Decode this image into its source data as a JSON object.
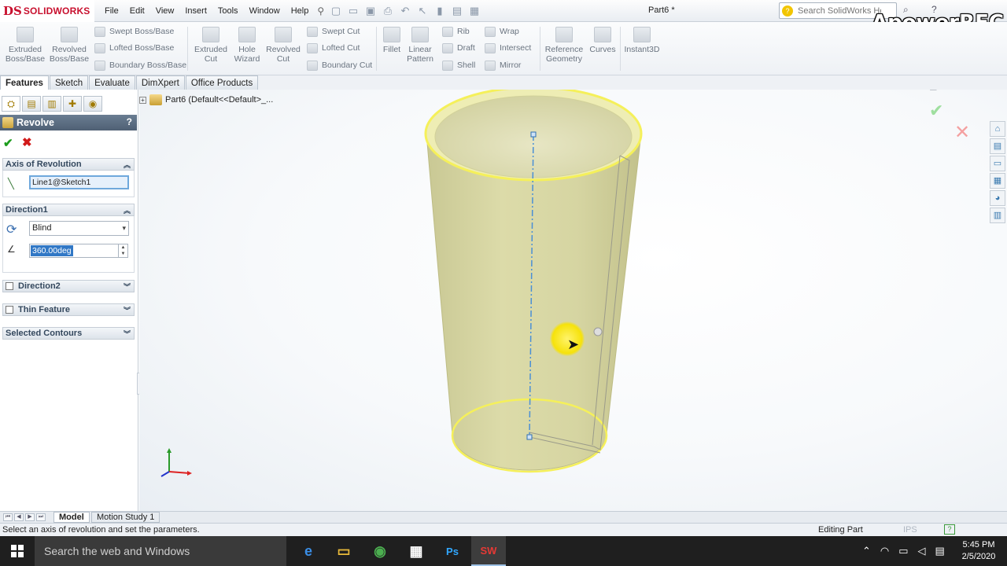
{
  "app": {
    "logo_mark": "DS",
    "logo_name": "SOLIDWORKS",
    "document_title": "Part6 *"
  },
  "menu": [
    "File",
    "Edit",
    "View",
    "Insert",
    "Tools",
    "Window",
    "Help"
  ],
  "search": {
    "placeholder": "Search SolidWorks Help"
  },
  "watermark": "ApowerREC",
  "ribbon": {
    "extruded_boss": "Extruded Boss/Base",
    "revolved_boss": "Revolved Boss/Base",
    "swept_boss": "Swept Boss/Base",
    "lofted_boss": "Lofted Boss/Base",
    "boundary_boss": "Boundary Boss/Base",
    "extruded_cut": "Extruded Cut",
    "hole_wizard": "Hole Wizard",
    "revolved_cut": "Revolved Cut",
    "swept_cut": "Swept Cut",
    "lofted_cut": "Lofted Cut",
    "boundary_cut": "Boundary Cut",
    "fillet": "Fillet",
    "linear_pattern": "Linear Pattern",
    "rib": "Rib",
    "draft": "Draft",
    "shell": "Shell",
    "wrap": "Wrap",
    "intersect": "Intersect",
    "mirror": "Mirror",
    "reference_geometry": "Reference Geometry",
    "curves": "Curves",
    "instant3d": "Instant3D"
  },
  "tabs": [
    "Features",
    "Sketch",
    "Evaluate",
    "DimXpert",
    "Office Products"
  ],
  "property_manager": {
    "title": "Revolve",
    "help": "?",
    "axis_group": "Axis of Revolution",
    "axis_value": "Line1@Sketch1",
    "direction1_group": "Direction1",
    "direction1_type": "Blind",
    "angle_value": "360.00deg",
    "direction2_group": "Direction2",
    "thin_feature_group": "Thin Feature",
    "selected_contours_group": "Selected Contours"
  },
  "tree": {
    "root": "Part6  (Default<<Default>_..."
  },
  "bottom_tabs": [
    "Model",
    "Motion Study 1"
  ],
  "status": {
    "message": "Select an axis of revolution and set the parameters.",
    "mode": "Editing Part",
    "units": "IPS"
  },
  "taskbar": {
    "search_placeholder": "Search the web and Windows",
    "time": "5:45 PM",
    "date": "2/5/2020"
  },
  "colors": {
    "model_fill": "#d8d7a6",
    "selection_yellow": "#f5f05a",
    "axis_blue": "#4a8fd6"
  }
}
